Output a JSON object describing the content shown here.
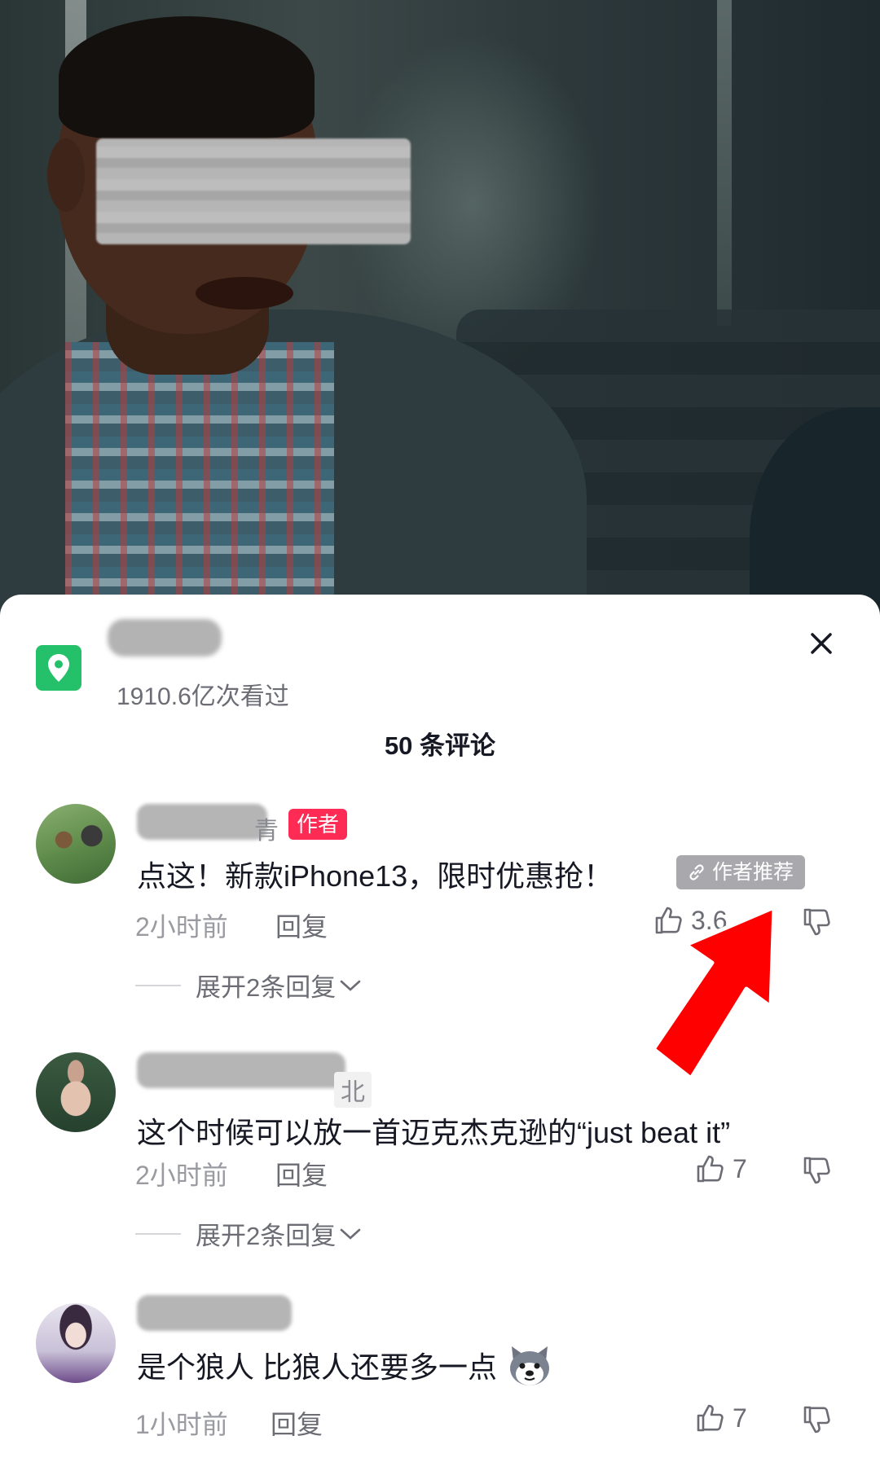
{
  "video": {
    "alt": ""
  },
  "header": {
    "views": "1910.6亿次看过",
    "close_icon": "close-icon",
    "location_icon": "location-pin-icon"
  },
  "comments_title": "50 条评论",
  "comments": [
    {
      "username_suffix": "青",
      "author_badge": "作者",
      "text": "点这！新款iPhone13，限时优惠抢！",
      "recommend_tag": "作者推荐",
      "time": "2小时前",
      "reply": "回复",
      "likes": "3.6",
      "expand": "展开2条回复"
    },
    {
      "username_suffix": "北",
      "text": "这个时候可以放一首迈克杰克逊的“just beat it”",
      "time": "2小时前",
      "reply": "回复",
      "likes": "7",
      "expand": "展开2条回复"
    },
    {
      "text": "是个狼人  比狼人还要多一点",
      "time": "1小时前",
      "reply": "回复",
      "likes": "7"
    }
  ],
  "colors": {
    "author_badge": "#fe2c55",
    "location": "#25c06a",
    "arrow": "#ff0000"
  }
}
